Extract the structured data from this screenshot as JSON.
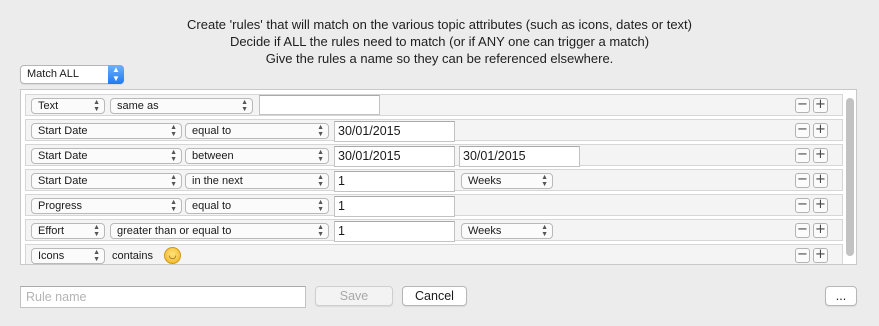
{
  "intro": {
    "line1": "Create 'rules' that will match on the various topic attributes (such as icons, dates or text)",
    "line2": "Decide if ALL the rules need to match (or if ANY one can trigger a match)",
    "line3": "Give the rules a name so they can be referenced elsewhere."
  },
  "match_mode": {
    "selected": "Match ALL"
  },
  "rules": [
    {
      "attribute": "Text",
      "operator": "same as",
      "value1": "",
      "value2": "",
      "unit": ""
    },
    {
      "attribute": "Start Date",
      "operator": "equal to",
      "value1": "30/01/2015",
      "value2": "",
      "unit": ""
    },
    {
      "attribute": "Start Date",
      "operator": "between",
      "value1": "30/01/2015",
      "value2": "30/01/2015",
      "unit": ""
    },
    {
      "attribute": "Start Date",
      "operator": "in the next",
      "value1": "1",
      "value2": "",
      "unit": "Weeks"
    },
    {
      "attribute": "Progress",
      "operator": "equal to",
      "value1": "1",
      "value2": "",
      "unit": ""
    },
    {
      "attribute": "Effort",
      "operator": "greater than or equal to",
      "value1": "1",
      "value2": "",
      "unit": "Weeks"
    },
    {
      "attribute": "Icons",
      "operator": "contains",
      "value1": "",
      "value2": "",
      "unit": "",
      "icon": "smiley-icon"
    }
  ],
  "row_controls": {
    "remove": "−",
    "add": "+"
  },
  "footer": {
    "rule_name_placeholder": "Rule name",
    "save_label": "Save",
    "cancel_label": "Cancel",
    "more_label": "..."
  }
}
